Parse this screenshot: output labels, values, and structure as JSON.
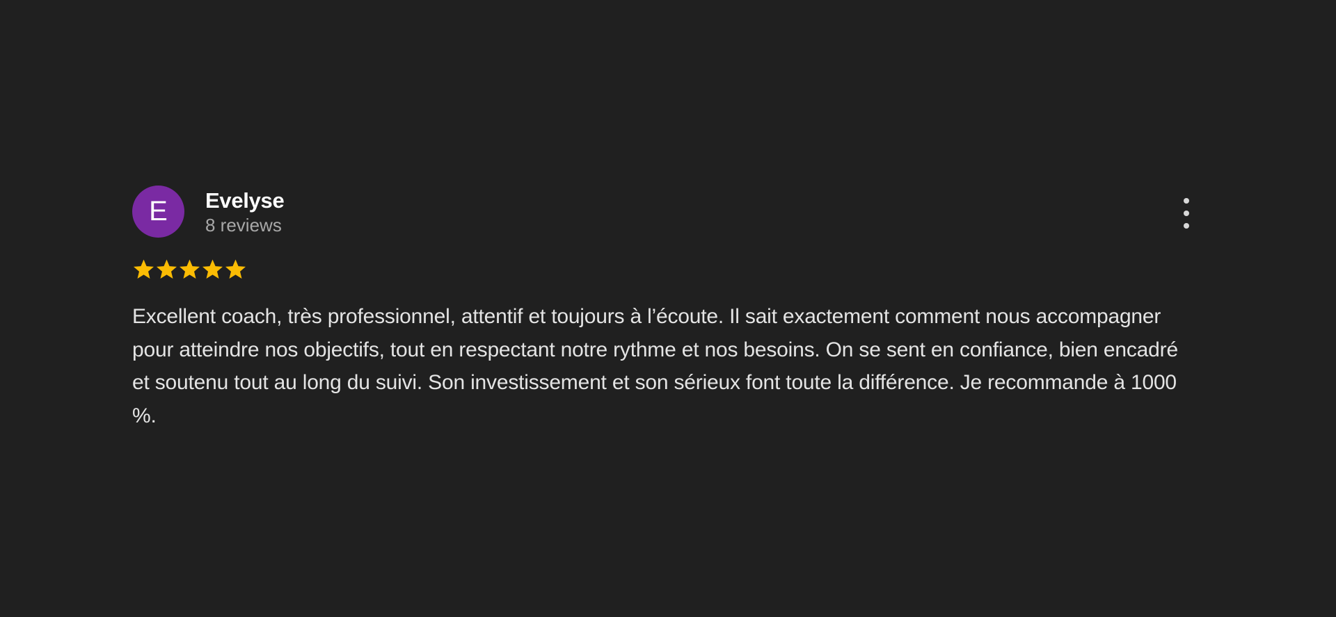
{
  "review": {
    "avatar_letter": "E",
    "avatar_color": "#7a2aa3",
    "author_name": "Evelyse",
    "review_count": "8 reviews",
    "rating": 5,
    "rating_max": 5,
    "star_color": "#fbbc04",
    "text": "Excellent coach, très professionnel, attentif et toujours à l’écoute. Il sait exactement comment nous accompagner pour atteindre nos objectifs, tout en respectant notre rythme et nos besoins. On se sent en confiance, bien encadré et soutenu tout au long du suivi. Son investissement et son sérieux font toute la différence. Je recommande à 1000 %.",
    "more_icon": "more-vert-icon",
    "star_icon": "star-icon"
  }
}
